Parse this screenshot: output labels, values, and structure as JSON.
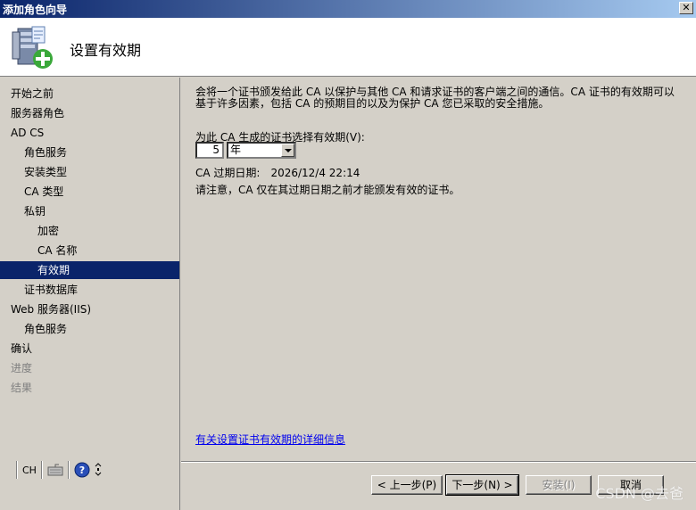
{
  "window": {
    "title": "添加角色向导",
    "close_label": "✕"
  },
  "header": {
    "title": "设置有效期",
    "icon": "server-add-icon"
  },
  "sidebar": {
    "items": [
      {
        "label": "开始之前",
        "level": 0,
        "state": "normal"
      },
      {
        "label": "服务器角色",
        "level": 0,
        "state": "normal"
      },
      {
        "label": "AD CS",
        "level": 0,
        "state": "normal"
      },
      {
        "label": "角色服务",
        "level": 1,
        "state": "normal"
      },
      {
        "label": "安装类型",
        "level": 1,
        "state": "normal"
      },
      {
        "label": "CA 类型",
        "level": 1,
        "state": "normal"
      },
      {
        "label": "私钥",
        "level": 1,
        "state": "normal"
      },
      {
        "label": "加密",
        "level": 2,
        "state": "normal"
      },
      {
        "label": "CA 名称",
        "level": 2,
        "state": "normal"
      },
      {
        "label": "有效期",
        "level": 2,
        "state": "active"
      },
      {
        "label": "证书数据库",
        "level": 1,
        "state": "normal"
      },
      {
        "label": "Web 服务器(IIS)",
        "level": 0,
        "state": "normal"
      },
      {
        "label": "角色服务",
        "level": 1,
        "state": "normal"
      },
      {
        "label": "确认",
        "level": 0,
        "state": "normal"
      },
      {
        "label": "进度",
        "level": 0,
        "state": "disabled"
      },
      {
        "label": "结果",
        "level": 0,
        "state": "disabled"
      }
    ]
  },
  "langbar": {
    "language": "CH"
  },
  "main": {
    "intro": "会将一个证书颁发给此 CA 以保护与其他 CA 和请求证书的客户端之间的通信。CA 证书的有效期可以基于许多因素，包括 CA 的预期目的以及为保护 CA 您已采取的安全措施。",
    "period_label": "为此 CA 生成的证书选择有效期(V):",
    "period_value": "5",
    "period_unit": "年",
    "expire_label": "CA 过期日期:",
    "expire_value": "2026/12/4 22:14",
    "note": "请注意，CA 仅在其过期日期之前才能颁发有效的证书。",
    "more_link": "有关设置证书有效期的详细信息"
  },
  "buttons": {
    "back": "< 上一步(P)",
    "next": "下一步(N) >",
    "install": "安装(I)",
    "cancel": "取消"
  },
  "watermark": "CSDN @去爸"
}
